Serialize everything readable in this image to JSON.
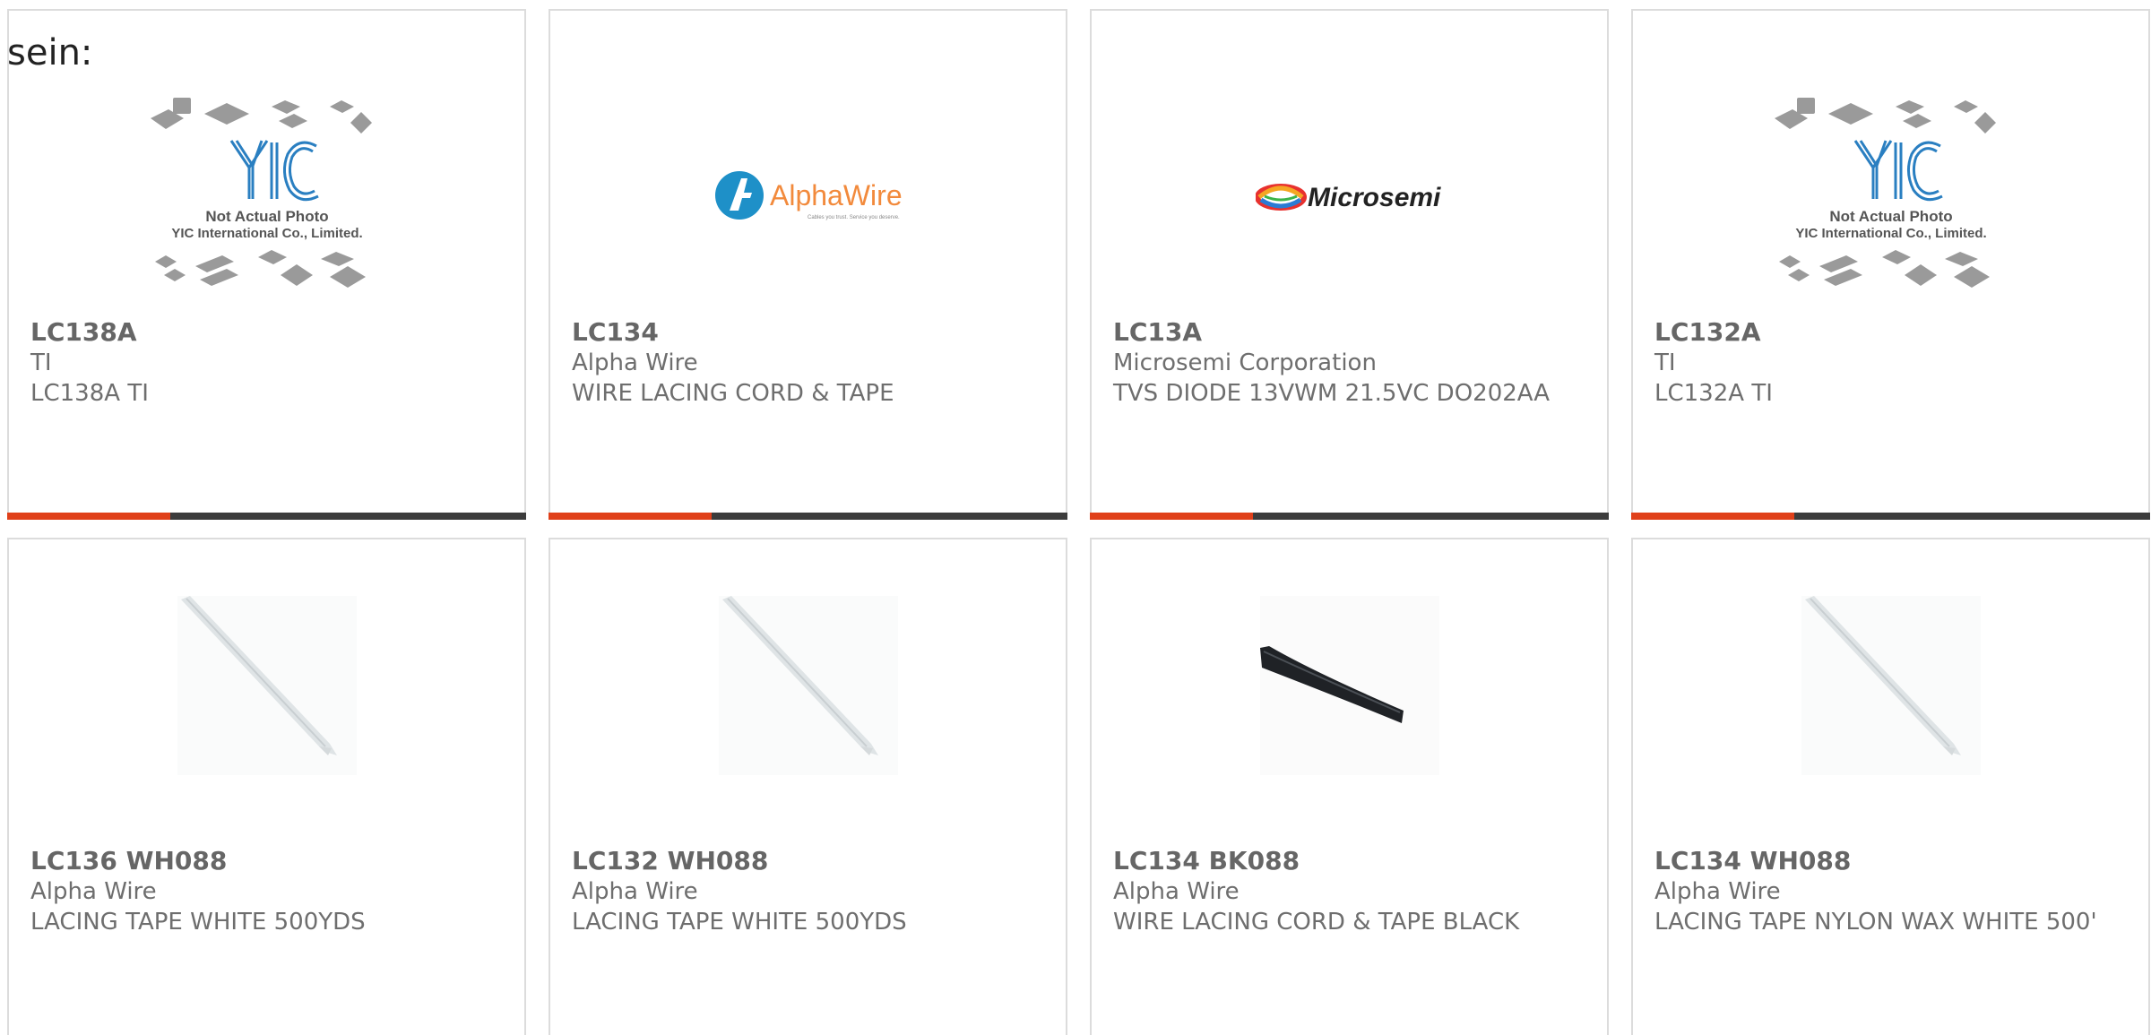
{
  "header_label": "sein:",
  "accent_color": "#e0401a",
  "bar_color": "#3c3c3c",
  "placeholder": {
    "logo_text": "YIC",
    "line1": "Not Actual Photo",
    "line2": "YIC International Co., Limited."
  },
  "brand_alphawire": {
    "name": "AlphaWire",
    "tagline": "Cables you trust. Service you deserve."
  },
  "brand_microsemi": {
    "name": "Microsemi"
  },
  "products": [
    {
      "part": "LC138A",
      "maker": "TI",
      "desc": "LC138A TI",
      "image": "yic-placeholder"
    },
    {
      "part": "LC134",
      "maker": "Alpha Wire",
      "desc": "WIRE LACING CORD & TAPE",
      "image": "alphawire-logo"
    },
    {
      "part": "LC13A",
      "maker": "Microsemi Corporation",
      "desc": "TVS DIODE 13VWM 21.5VC DO202AA",
      "image": "microsemi-logo"
    },
    {
      "part": "LC132A",
      "maker": "TI",
      "desc": "LC132A TI",
      "image": "yic-placeholder"
    },
    {
      "part": "LC136 WH088",
      "maker": "Alpha Wire",
      "desc": "LACING TAPE WHITE 500YDS",
      "image": "white-tape"
    },
    {
      "part": "LC132 WH088",
      "maker": "Alpha Wire",
      "desc": "LACING TAPE WHITE 500YDS",
      "image": "white-tape"
    },
    {
      "part": "LC134 BK088",
      "maker": "Alpha Wire",
      "desc": "WIRE LACING CORD & TAPE BLACK",
      "image": "black-tape"
    },
    {
      "part": "LC134 WH088",
      "maker": "Alpha Wire",
      "desc": "LACING TAPE NYLON WAX WHITE 500'",
      "image": "white-tape"
    }
  ]
}
